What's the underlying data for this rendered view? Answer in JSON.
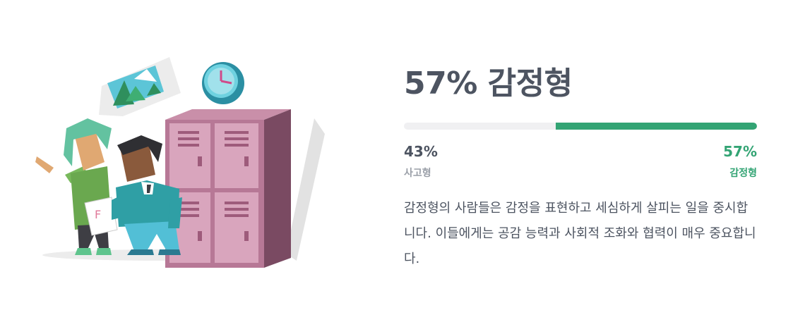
{
  "result": {
    "headline": "57% 감정형",
    "feeling_fraction": 0.57,
    "left": {
      "percent": "43%",
      "label": "사고형"
    },
    "right": {
      "percent": "57%",
      "label": "감정형"
    },
    "description": "감정형의 사람들은 감정을 표현하고 세심하게 살피는 일을 중시합니다. 이들에게는 공감 능력과 사회적 조화와 협력이 매우 중요합니다."
  },
  "colors": {
    "accent": "#33a474",
    "text": "#4d5461",
    "muted": "#9a9fa8",
    "track": "#f0f0f2"
  },
  "illustration": {
    "scene": "school-lockers-classmates",
    "icons": [
      "mountain-landscape-thought-bubble",
      "wall-clock",
      "failed-test-paper"
    ]
  }
}
